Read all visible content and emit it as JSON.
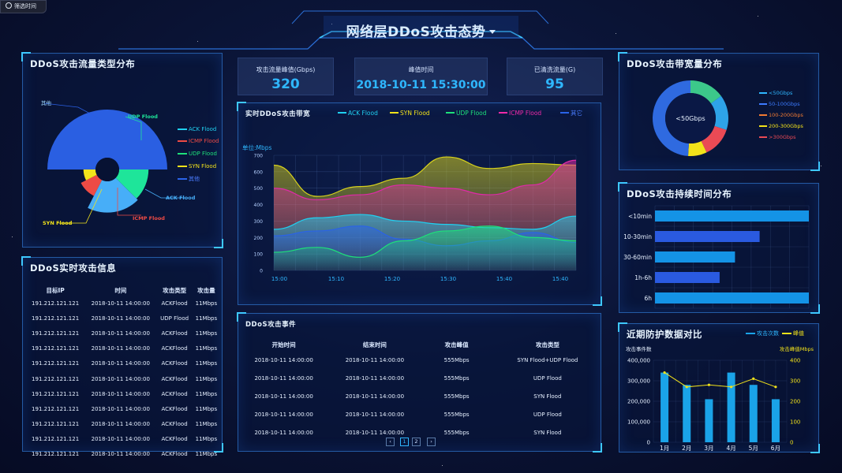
{
  "header": {
    "filter_label": "筛选时间",
    "title": "网络层DDoS攻击态势",
    "dropdown_icon": "caret-down-icon"
  },
  "kpis": [
    {
      "label": "攻击流量峰值(Gbps)",
      "value": "320"
    },
    {
      "label": "峰值时间",
      "value": "2018-10-11 15:30:00"
    },
    {
      "label": "已清洗流量(G)",
      "value": "95"
    }
  ],
  "traffic_type": {
    "title": "DDoS攻击流量类型分布",
    "legend": [
      "ACK Flood",
      "ICMP Flood",
      "UDP Flood",
      "SYN Flood",
      "其他"
    ],
    "slice_labels": [
      "其他",
      "UDP Flood",
      "ACK Flood",
      "ICMP Flood",
      "SYN Flood"
    ]
  },
  "realtime_info": {
    "title": "DDoS实时攻击信息",
    "columns": [
      "目标IP",
      "时间",
      "攻击类型",
      "攻击量"
    ],
    "rows": [
      [
        "191.212.121.121",
        "2018-10-11 14:00:00",
        "ACKFlood",
        "11Mbps"
      ],
      [
        "191.212.121.121",
        "2018-10-11 14:00:00",
        "UDP Flood",
        "11Mbps"
      ],
      [
        "191.212.121.121",
        "2018-10-11 14:00:00",
        "ACKFlood",
        "11Mbps"
      ],
      [
        "191.212.121.121",
        "2018-10-11 14:00:00",
        "ACKFlood",
        "11Mbps"
      ],
      [
        "191.212.121.121",
        "2018-10-11 14:00:00",
        "ACKFlood",
        "11Mbps"
      ],
      [
        "191.212.121.121",
        "2018-10-11 14:00:00",
        "ACKFlood",
        "11Mbps"
      ],
      [
        "191.212.121.121",
        "2018-10-11 14:00:00",
        "ACKFlood",
        "11Mbps"
      ],
      [
        "191.212.121.121",
        "2018-10-11 14:00:00",
        "ACKFlood",
        "11Mbps"
      ],
      [
        "191.212.121.121",
        "2018-10-11 14:00:00",
        "ACKFlood",
        "11Mbps"
      ],
      [
        "191.212.121.121",
        "2018-10-11 14:00:00",
        "ACKFlood",
        "11Mbps"
      ],
      [
        "191.212.121.121",
        "2018-10-11 14:00:00",
        "ACKFlood",
        "11Mbps"
      ]
    ]
  },
  "bandwidth": {
    "title": "实时DDoS攻击带宽",
    "unit_label": "单位:Mbps",
    "legend": [
      "ACK Flood",
      "SYN Flood",
      "UDP Flood",
      "ICMP Flood",
      "其它"
    ]
  },
  "events": {
    "title": "DDoS攻击事件",
    "columns": [
      "开始时间",
      "结束时间",
      "攻击峰值",
      "攻击类型"
    ],
    "rows": [
      [
        "2018-10-11 14:00:00",
        "2018-10-11 14:00:00",
        "555Mbps",
        "SYN Flood+UDP Flood"
      ],
      [
        "2018-10-11 14:00:00",
        "2018-10-11 14:00:00",
        "555Mbps",
        "UDP Flood"
      ],
      [
        "2018-10-11 14:00:00",
        "2018-10-11 14:00:00",
        "555Mbps",
        "SYN Flood"
      ],
      [
        "2018-10-11 14:00:00",
        "2018-10-11 14:00:00",
        "555Mbps",
        "UDP Flood"
      ],
      [
        "2018-10-11 14:00:00",
        "2018-10-11 14:00:00",
        "555Mbps",
        "SYN Flood"
      ]
    ],
    "pagination": {
      "prev": "‹",
      "pages": [
        "1",
        "2"
      ],
      "next": "›",
      "current": "1"
    }
  },
  "bw_dist": {
    "title": "DDoS攻击带宽量分布",
    "center_label": "<50Gbps",
    "legend": [
      "<50Gbps",
      "50-100Gbps",
      "100-200Gbps",
      "200-300Gbps",
      ">300Gbps"
    ]
  },
  "duration": {
    "title": "DDoS攻击持续时间分布"
  },
  "compare": {
    "title": "近期防护数据对比",
    "legend": [
      "攻击次数",
      "峰值"
    ],
    "left_axis_title": "攻击事件数",
    "right_axis_title": "攻击峰值Mbps"
  },
  "colors": {
    "ack": "#20d0f0",
    "syn": "#f2e21a",
    "udp": "#1ee07a",
    "icmp": "#f02aa8",
    "other": "#2a63e8",
    "accent": "#2fb7ff",
    "bar": "#1aa3e8"
  },
  "chart_data": [
    {
      "type": "pie",
      "name": "traffic_type",
      "categories": [
        "其他",
        "UDP Flood",
        "ACK Flood",
        "ICMP Flood",
        "SYN Flood"
      ],
      "values": [
        50,
        12.5,
        20,
        10,
        7.5
      ],
      "radius_scale": [
        1.0,
        0.61,
        0.65,
        0.37,
        0.25
      ],
      "colors": [
        "#2a5fe2",
        "#1ee59a",
        "#47aef8",
        "#ee4b45",
        "#f3e51b"
      ],
      "rose": true
    },
    {
      "type": "area",
      "name": "bandwidth",
      "x": [
        "15:00",
        "15:10",
        "15:20",
        "15:30",
        "15:40",
        "15:40"
      ],
      "ylim": [
        0,
        700
      ],
      "yticks": [
        0,
        100,
        200,
        300,
        400,
        500,
        600,
        700
      ],
      "series": [
        {
          "name": "SYN Flood",
          "values": [
            640,
            450,
            510,
            560,
            690,
            620,
            650,
            640
          ]
        },
        {
          "name": "ICMP Flood",
          "values": [
            500,
            430,
            460,
            520,
            500,
            460,
            520,
            670
          ]
        },
        {
          "name": "ACK Flood",
          "values": [
            250,
            320,
            340,
            300,
            280,
            260,
            250,
            330
          ]
        },
        {
          "name": "其它",
          "values": [
            210,
            240,
            270,
            190,
            150,
            180,
            230,
            170
          ]
        },
        {
          "name": "UDP Flood",
          "values": [
            110,
            140,
            80,
            180,
            240,
            270,
            200,
            180
          ]
        }
      ]
    },
    {
      "type": "pie",
      "name": "bw_dist",
      "categories": [
        "<50Gbps",
        "50-100Gbps",
        "100-200Gbps",
        "200-300Gbps",
        ">300Gbps"
      ],
      "values": [
        50,
        15,
        10,
        10,
        15
      ],
      "colors": [
        "#2f6ae0",
        "#2ea3e8",
        "#f07a32",
        "#f2e21a",
        "#ea4a55"
      ],
      "donut": true
    },
    {
      "type": "bar",
      "name": "duration",
      "orientation": "horizontal",
      "categories": [
        "<10min",
        "10-30min",
        "30-60min",
        "1h-6h",
        "6h"
      ],
      "values": [
        100,
        68,
        52,
        42,
        100
      ],
      "xlim": [
        0,
        100
      ]
    },
    {
      "type": "bar",
      "name": "compare",
      "categories": [
        "1月",
        "2月",
        "3月",
        "4月",
        "5月",
        "6月"
      ],
      "series": [
        {
          "name": "攻击次数",
          "type": "bar",
          "axis": "left",
          "values": [
            340000,
            280000,
            210000,
            340000,
            280000,
            210000
          ]
        },
        {
          "name": "峰值",
          "type": "line",
          "axis": "right",
          "values": [
            340,
            270,
            280,
            270,
            310,
            270
          ]
        }
      ],
      "ylim_left": [
        0,
        400000
      ],
      "yticks_left": [
        "0",
        "100,000",
        "200,000",
        "300,000",
        "400,000"
      ],
      "ylim_right": [
        0,
        400
      ],
      "yticks_right": [
        "0",
        "100",
        "200",
        "300",
        "400"
      ]
    }
  ]
}
